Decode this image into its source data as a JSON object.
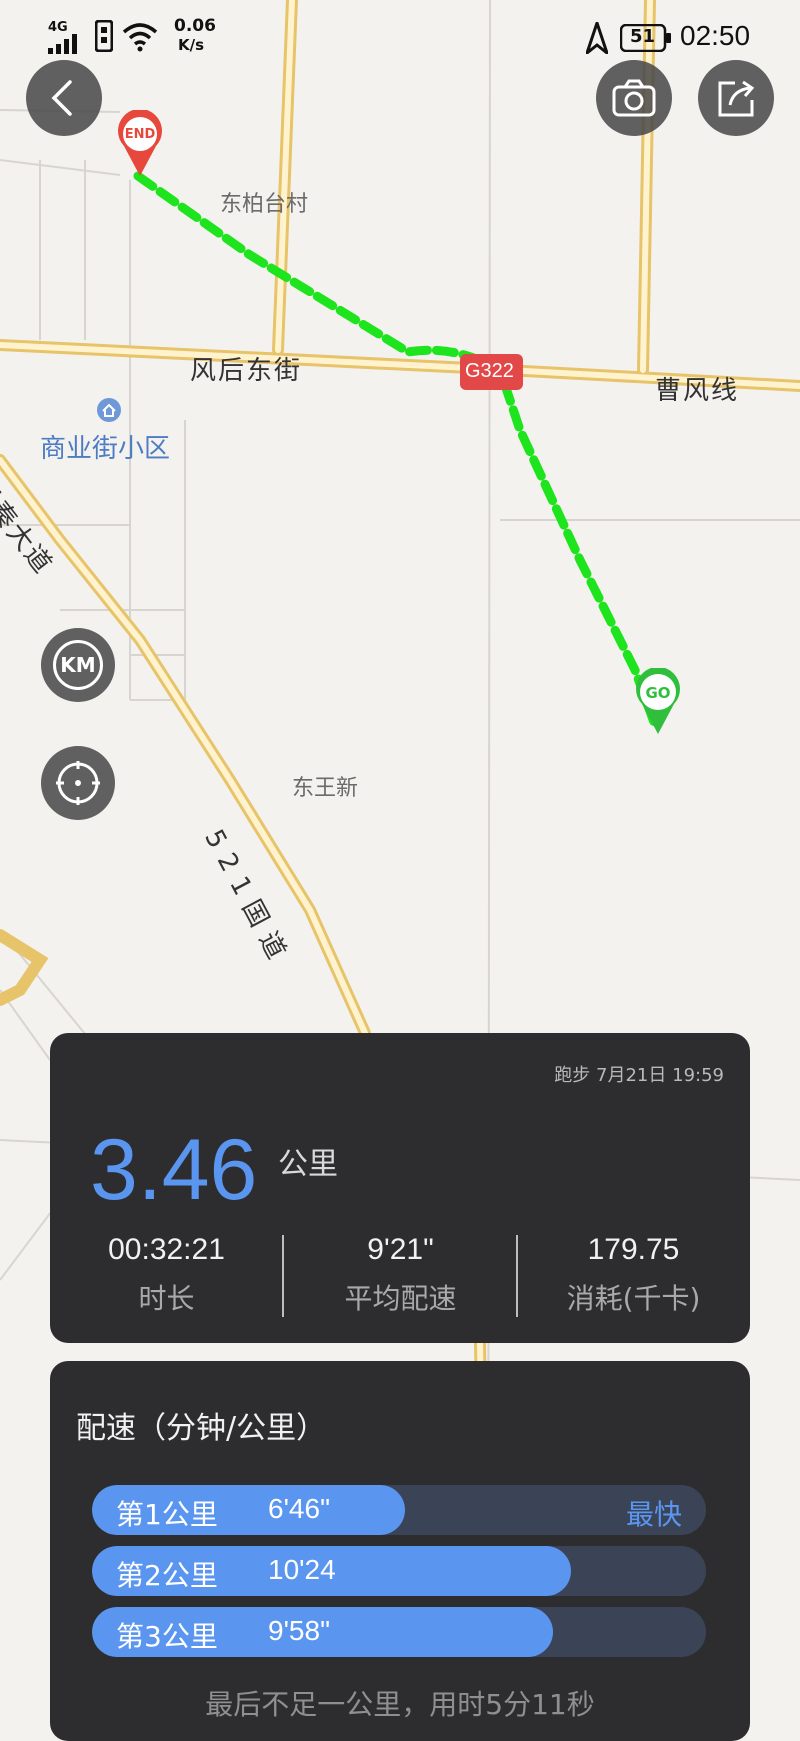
{
  "status_bar": {
    "network": "4G",
    "speed_value": "0.06",
    "speed_unit": "K/s",
    "battery": "51",
    "time": "02:50"
  },
  "map": {
    "labels": {
      "village_north": "东柏台村",
      "street_west": "风后东街",
      "road_badge": "G322",
      "street_east": "曹风线",
      "poi": "商业街小区",
      "avenue": "禹秦大道",
      "village_south": "东王新",
      "national_road": "521国道"
    },
    "route_color": "#1ee41e"
  },
  "markers": {
    "end": "END",
    "start": "GO"
  },
  "summary": {
    "activity": "跑步",
    "date": "7月21日",
    "time": "19:59",
    "distance": "3.46",
    "distance_unit": "公里",
    "stats": [
      {
        "value": "00:32:21",
        "label": "时长"
      },
      {
        "value": "9'21\"",
        "label": "平均配速"
      },
      {
        "value": "179.75",
        "label": "消耗(千卡)"
      }
    ]
  },
  "pace": {
    "title": "配速（分钟/公里）",
    "rows": [
      {
        "name": "第1公里",
        "pace": "6'46\"",
        "badge": "最快",
        "fill_fraction": 0.51
      },
      {
        "name": "第2公里",
        "pace": "10'24",
        "badge": "",
        "fill_fraction": 0.78
      },
      {
        "name": "第3公里",
        "pace": "9'58\"",
        "badge": "",
        "fill_fraction": 0.75
      }
    ],
    "remark": "最后不足一公里，用时5分11秒"
  },
  "colors": {
    "accent": "#5a96f0",
    "card_bg": "#2d2d2f",
    "end_marker": "#e8473c",
    "start_marker": "#2fbf3c"
  }
}
